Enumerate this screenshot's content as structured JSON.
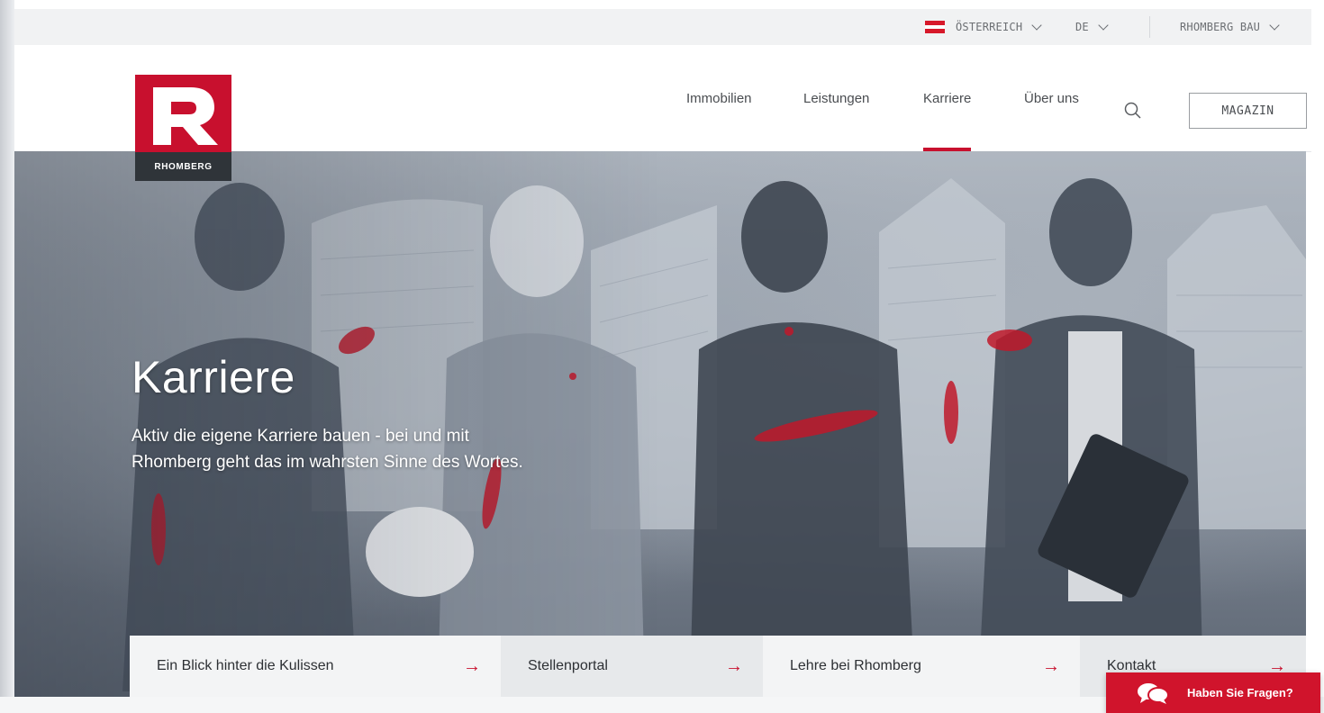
{
  "utility": {
    "country": "ÖSTERREICH",
    "language": "DE",
    "company": "RHOMBERG BAU"
  },
  "logo": {
    "letter": "R",
    "wordmark": "RHOMBERG"
  },
  "nav": {
    "items": [
      {
        "label": "Immobilien"
      },
      {
        "label": "Leistungen"
      },
      {
        "label": "Karriere"
      },
      {
        "label": "Über uns"
      }
    ],
    "magazin_label": "MAGAZIN"
  },
  "hero": {
    "title": "Karriere",
    "subtitle_line1": "Aktiv die eigene Karriere bauen - bei und mit",
    "subtitle_line2": "Rhomberg geht das im wahrsten Sinne des Wortes."
  },
  "quick_links": [
    {
      "label": "Ein Blick hinter die Kulissen",
      "arrow": "→"
    },
    {
      "label": "Stellenportal",
      "arrow": "→"
    },
    {
      "label": "Lehre bei Rhomberg",
      "arrow": "→"
    },
    {
      "label": "Kontakt",
      "arrow": "→"
    }
  ],
  "chat": {
    "label": "Haben Sie Fragen?"
  },
  "colors": {
    "brand_red": "#c8102e",
    "dark_grey": "#2f3439"
  },
  "icons": [
    "austria-flag-icon",
    "chevron-down-icon",
    "search-icon",
    "chat-bubbles-icon",
    "arrow-right-icon"
  ]
}
